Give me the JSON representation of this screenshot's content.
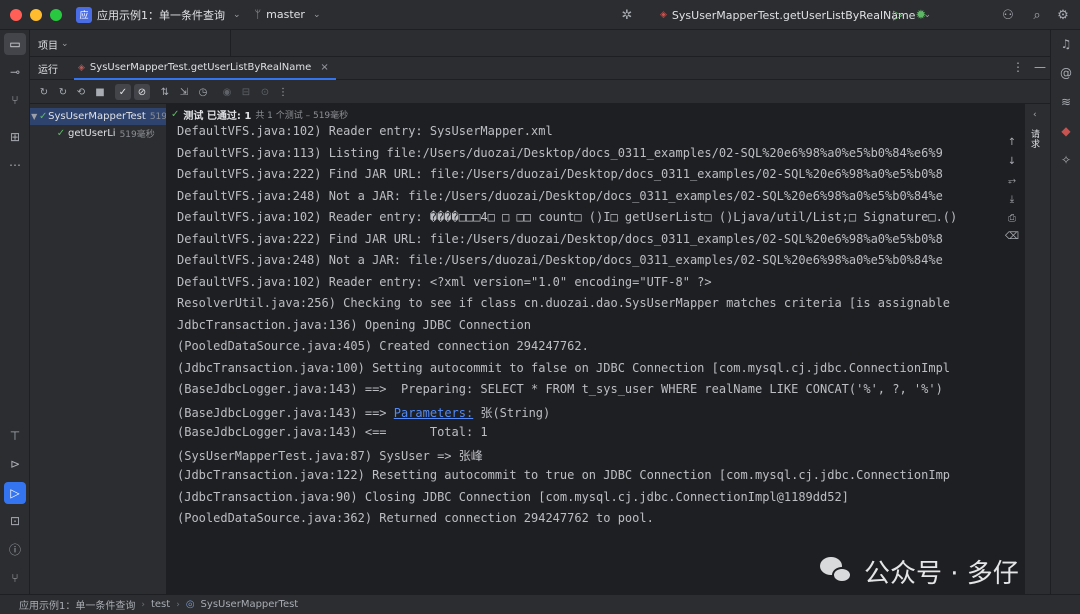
{
  "titlebar": {
    "project_badge": "应",
    "project_name": "应用示例1：单一条件查询",
    "branch": "master",
    "run_config": "SysUserMapperTest.getUserListByRealName",
    "icons": [
      "bug-settings-icon",
      "run-icon",
      "debug-icon",
      "add-user-icon",
      "search-icon",
      "settings-icon"
    ]
  },
  "project_panel": {
    "label": "项目"
  },
  "run_panel": {
    "label": "运行",
    "tab_label": "SysUserMapperTest.getUserListByRealName",
    "close": "×",
    "more": "⋮",
    "minimize": "—"
  },
  "status": {
    "passed": "测试 已通过: 1",
    "detail": "共 1 个测试 – 519毫秒"
  },
  "tree": [
    {
      "name": "SysUserMapperTest",
      "time": "519",
      "expanded": true,
      "selected": true
    },
    {
      "name": "getUserLi",
      "time": "519毫秒",
      "expanded": false,
      "selected": false
    }
  ],
  "console_lines": [
    {
      "text": "DefaultVFS.java:102) Reader entry: SysUserMapper.xml"
    },
    {
      "text": "DefaultVFS.java:113) Listing file:/Users/duozai/Desktop/docs_0311_examples/02-SQL%20e6%98%a0%e5%b0%84%e6%9"
    },
    {
      "text": "DefaultVFS.java:222) Find JAR URL: file:/Users/duozai/Desktop/docs_0311_examples/02-SQL%20e6%98%a0%e5%b0%8"
    },
    {
      "text": "DefaultVFS.java:248) Not a JAR: file:/Users/duozai/Desktop/docs_0311_examples/02-SQL%20e6%98%a0%e5%b0%84%e"
    },
    {
      "text": "DefaultVFS.java:102) Reader entry: ����□□□4□ □ □□ count□ ()I□ getUserList□ ()Ljava/util/List;□ Signature□.()"
    },
    {
      "text": "DefaultVFS.java:222) Find JAR URL: file:/Users/duozai/Desktop/docs_0311_examples/02-SQL%20e6%98%a0%e5%b0%8"
    },
    {
      "text": "DefaultVFS.java:248) Not a JAR: file:/Users/duozai/Desktop/docs_0311_examples/02-SQL%20e6%98%a0%e5%b0%84%e"
    },
    {
      "text": "DefaultVFS.java:102) Reader entry: <?xml version=\"1.0\" encoding=\"UTF-8\" ?>"
    },
    {
      "text": "ResolverUtil.java:256) Checking to see if class cn.duozai.dao.SysUserMapper matches criteria [is assignable"
    },
    {
      "text": "JdbcTransaction.java:136) Opening JDBC Connection"
    },
    {
      "text": "(PooledDataSource.java:405) Created connection 294247762."
    },
    {
      "text": "(JdbcTransaction.java:100) Setting autocommit to false on JDBC Connection [com.mysql.cj.jdbc.ConnectionImpl"
    },
    {
      "text": "(BaseJdbcLogger.java:143) ==>  Preparing: SELECT * FROM t_sys_user WHERE realName LIKE CONCAT('%', ?, '%')"
    },
    {
      "pre": "(BaseJdbcLogger.java:143) ==> ",
      "link": "Parameters:",
      "post": " 张(String)"
    },
    {
      "text": "(BaseJdbcLogger.java:143) <==      Total: 1"
    },
    {
      "text": "(SysUserMapperTest.java:87) SysUser => 张峰"
    },
    {
      "text": "(JdbcTransaction.java:122) Resetting autocommit to true on JDBC Connection [com.mysql.cj.jdbc.ConnectionImp"
    },
    {
      "text": "(JdbcTransaction.java:90) Closing JDBC Connection [com.mysql.cj.jdbc.ConnectionImpl@1189dd52]"
    },
    {
      "text": "(PooledDataSource.java:362) Returned connection 294247762 to pool."
    }
  ],
  "side_panel": {
    "label": "请求"
  },
  "watermark": {
    "text": "公众号 · 多仔"
  },
  "statusbar": {
    "crumbs": [
      "应用示例1：单一条件查询",
      "test",
      "SysUserMapperTest"
    ]
  },
  "colors": {
    "accent": "#3574f0",
    "pass": "#5fb865",
    "link": "#548af7",
    "bg": "#1e1f22",
    "panel": "#2b2d30"
  }
}
